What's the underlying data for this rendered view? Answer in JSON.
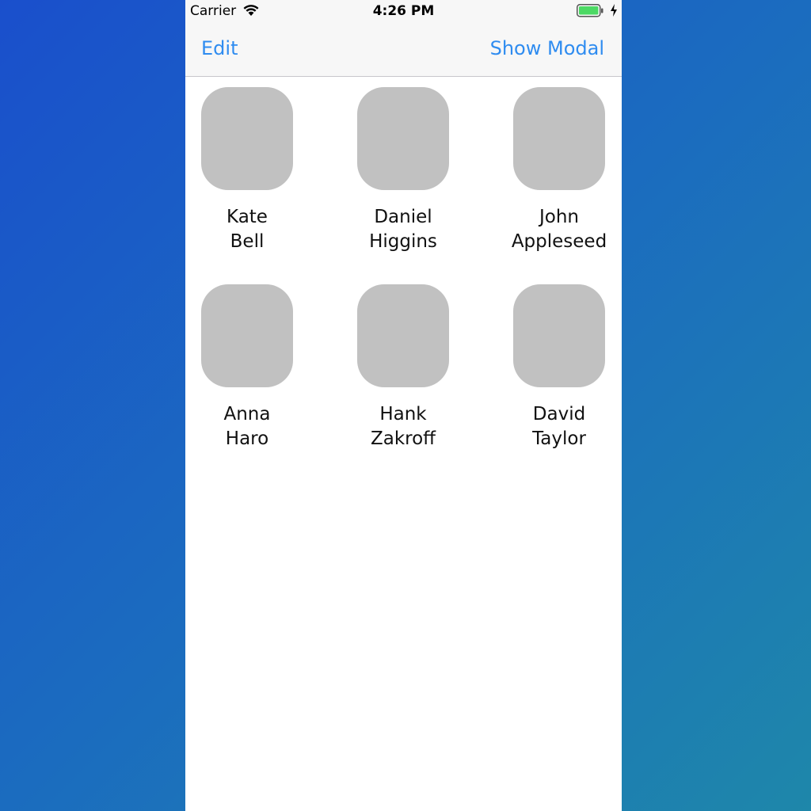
{
  "status_bar": {
    "carrier": "Carrier",
    "time": "4:26 PM",
    "battery_color": "#4cd964"
  },
  "nav_bar": {
    "left_button": "Edit",
    "right_button": "Show Modal"
  },
  "contacts": [
    {
      "first": "Kate",
      "last": "Bell"
    },
    {
      "first": "Daniel",
      "last": "Higgins"
    },
    {
      "first": "John",
      "last": "Appleseed"
    },
    {
      "first": "Anna",
      "last": "Haro"
    },
    {
      "first": "Hank",
      "last": "Zakroff"
    },
    {
      "first": "David",
      "last": "Taylor"
    }
  ],
  "colors": {
    "accent": "#2f8cf0",
    "avatar_placeholder": "#c1c1c1"
  }
}
